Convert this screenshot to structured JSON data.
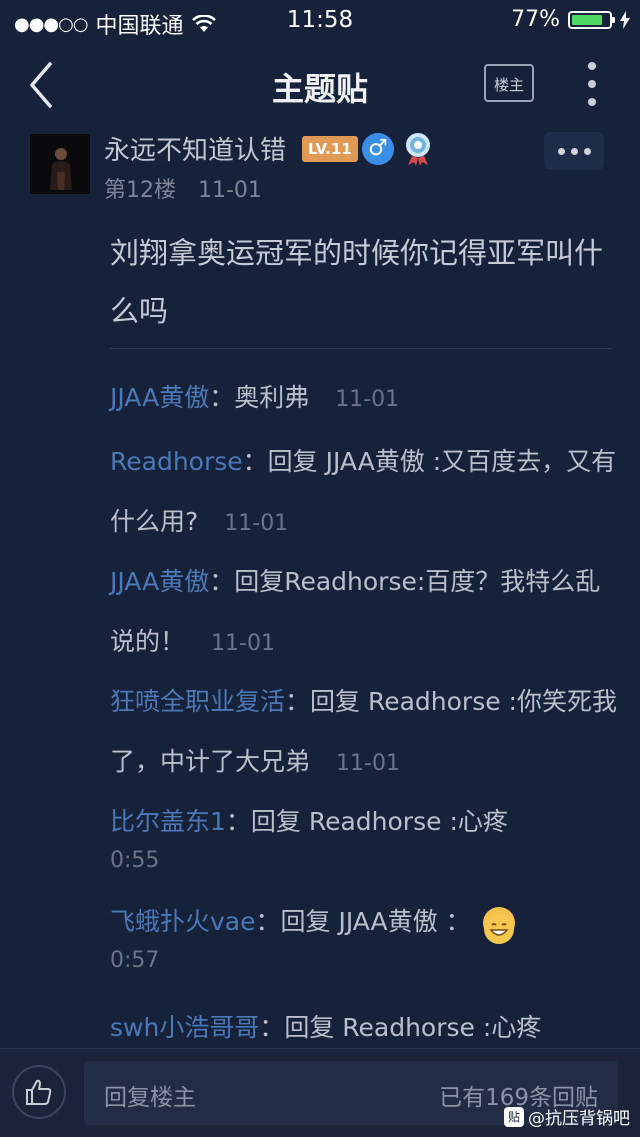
{
  "status_bar": {
    "signal": "●●●○○",
    "carrier": "中国联通",
    "time": "11:58",
    "battery_pct": "77%",
    "battery_color": "#4cd964"
  },
  "nav": {
    "back_icon": "chevron-left-icon",
    "title": "主题贴",
    "louzhu_button": "楼主",
    "more_icon": "more-vertical-icon"
  },
  "post": {
    "username": "永远不知道认错",
    "level": "LV.11",
    "gender_icon": "male-icon",
    "gender_symbol": "♂",
    "floor": "第12楼",
    "date": "11-01",
    "content": "刘翔拿奥运冠军的时候你记得亚军叫什么吗"
  },
  "replies": [
    {
      "user": "JJAA黄傲",
      "text": "：奥利弗",
      "time": "11-01"
    },
    {
      "user": "Readhorse",
      "text": "：回复 JJAA黄傲 :又百度去，又有什么用?",
      "time": "11-01"
    },
    {
      "user": "JJAA黄傲",
      "text": "：回复Readhorse:百度？我特么乱说的！",
      "time": "11-01"
    },
    {
      "user": "狂喷全职业复活",
      "text": "：回复 Readhorse :你笑死我了，中计了大兄弟",
      "time": "11-01"
    },
    {
      "user": "比尔盖东1",
      "text": "：回复 Readhorse :心疼",
      "time": "0:55"
    },
    {
      "user": "飞蛾扑火vae",
      "text": "：回复 JJAA黄傲 ：",
      "emoji": "grinning-face-icon",
      "time": "0:57"
    },
    {
      "user": "swh小浩哥哥",
      "text": "：回复 Readhorse :心疼",
      "time": ""
    }
  ],
  "bottom": {
    "like_icon": "thumbs-up-icon",
    "placeholder": "回复楼主",
    "reply_count": "已有169条回贴"
  },
  "watermark": {
    "icon_text": "贴",
    "text": "@抗压背锅吧"
  },
  "colors": {
    "background": "#16213a",
    "username_link": "#4c78b6",
    "level_badge": "#e19a55"
  }
}
